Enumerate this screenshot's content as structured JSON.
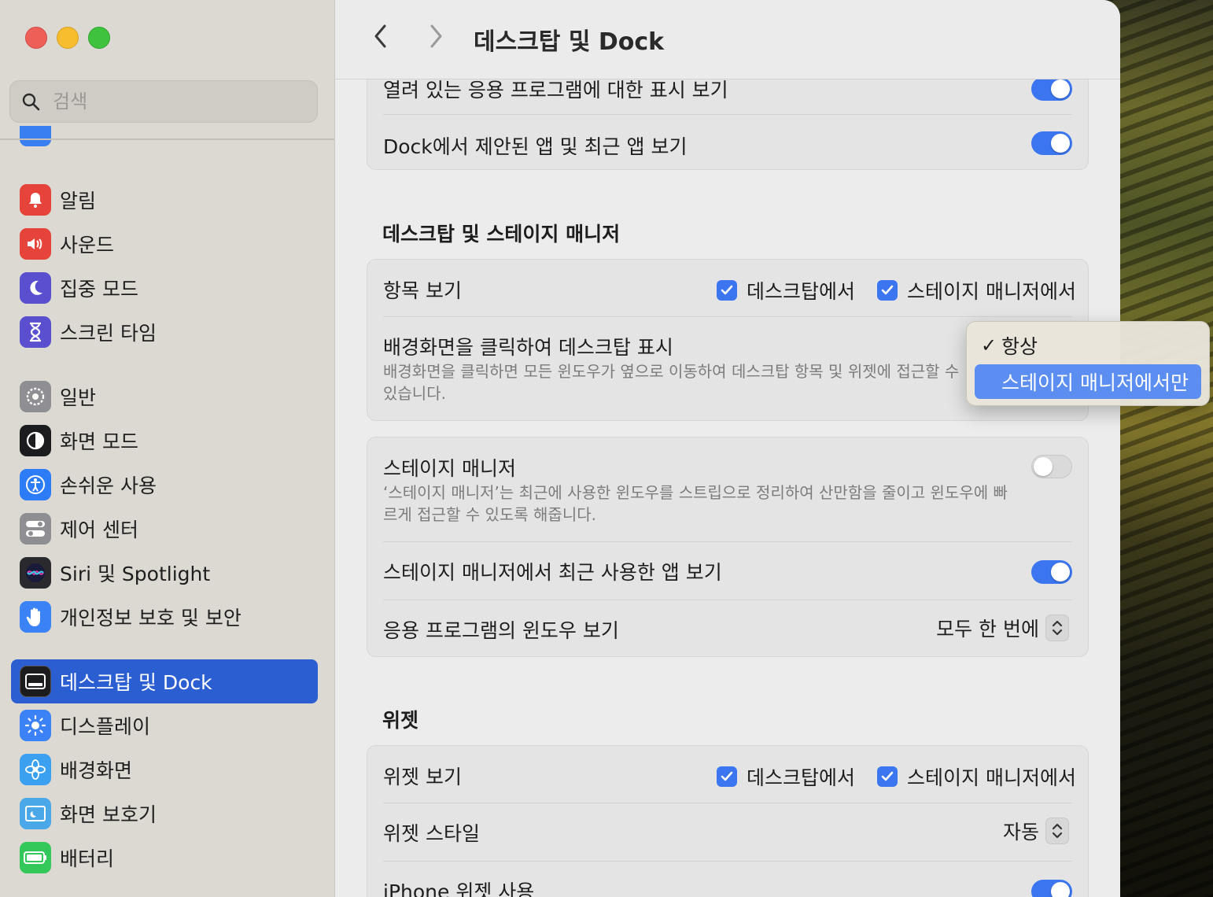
{
  "window": {
    "title": "데스크탑 및 Dock"
  },
  "search": {
    "placeholder": "검색"
  },
  "sidebar": {
    "items": [
      {
        "id": "notifications",
        "label": "알림",
        "icon": "bell-icon",
        "color": "#e6443a"
      },
      {
        "id": "sound",
        "label": "사운드",
        "icon": "speaker-icon",
        "color": "#e6443a"
      },
      {
        "id": "focus",
        "label": "집중 모드",
        "icon": "moon-icon",
        "color": "#5a4fcf"
      },
      {
        "id": "screen-time",
        "label": "스크린 타임",
        "icon": "hourglass-icon",
        "color": "#5a4fcf"
      },
      {
        "id": "general",
        "label": "일반",
        "icon": "gear-icon",
        "color": "#8e8e93"
      },
      {
        "id": "appearance",
        "label": "화면 모드",
        "icon": "appearance-icon",
        "color": "#1c1c1e"
      },
      {
        "id": "accessibility",
        "label": "손쉬운 사용",
        "icon": "accessibility-icon",
        "color": "#2b7cf6"
      },
      {
        "id": "control-center",
        "label": "제어 센터",
        "icon": "toggles-icon",
        "color": "#8e8e93"
      },
      {
        "id": "siri",
        "label": "Siri 및 Spotlight",
        "icon": "siri-icon",
        "color": "#2a2a2e"
      },
      {
        "id": "privacy",
        "label": "개인정보 보호 및 보안",
        "icon": "hand-icon",
        "color": "#3b82f6"
      },
      {
        "id": "desktop-dock",
        "label": "데스크탑 및 Dock",
        "icon": "dock-icon",
        "color": "#1c1c1e",
        "active": true
      },
      {
        "id": "displays",
        "label": "디스플레이",
        "icon": "sun-icon",
        "color": "#3b82f6"
      },
      {
        "id": "wallpaper",
        "label": "배경화면",
        "icon": "flower-icon",
        "color": "#3ba0f0"
      },
      {
        "id": "screen-saver",
        "label": "화면 보호기",
        "icon": "screensaver-icon",
        "color": "#4aa8e8"
      },
      {
        "id": "battery",
        "label": "배터리",
        "icon": "battery-icon",
        "color": "#34c759"
      }
    ]
  },
  "main": {
    "top_group": {
      "row1_label": "열려 있는 응용 프로그램에 대한 표시 보기",
      "row2_label": "Dock에서 제안된 앱 및 최근 앱 보기"
    },
    "desktop_section": {
      "title": "데스크탑 및 스테이지 매니저",
      "show_items_label": "항목 보기",
      "on_desktop": "데스크탑에서",
      "in_stage_manager": "스테이지 매니저에서",
      "click_wallpaper_label": "배경화면을 클릭하여 데스크탑 표시",
      "click_wallpaper_desc": "배경화면을 클릭하면 모든 윈도우가 옆으로 이동하여 데스크탑 항목 및 위젯에 접근할 수 있습니다."
    },
    "stage_group": {
      "stage_manager_label": "스테이지 매니저",
      "stage_manager_desc": "‘스테이지 매니저’는 최근에 사용한 윈도우를 스트립으로 정리하여 산만함을 줄이고 윈도우에 빠르게 접근할 수 있도록 해줍니다.",
      "recent_apps_label": "스테이지 매니저에서 최근 사용한 앱 보기",
      "app_windows_label": "응용 프로그램의 윈도우 보기",
      "app_windows_value": "모두 한 번에"
    },
    "widgets_section": {
      "title": "위젯",
      "show_widgets_label": "위젯 보기",
      "on_desktop": "데스크탑에서",
      "in_stage_manager": "스테이지 매니저에서",
      "style_label": "위젯 스타일",
      "style_value": "자동",
      "iphone_label": "iPhone 위젯 사용"
    }
  },
  "menu": {
    "options": [
      "항상",
      "스테이지 매니저에서만"
    ],
    "checked": "항상",
    "highlighted": "스테이지 매니저에서만"
  }
}
